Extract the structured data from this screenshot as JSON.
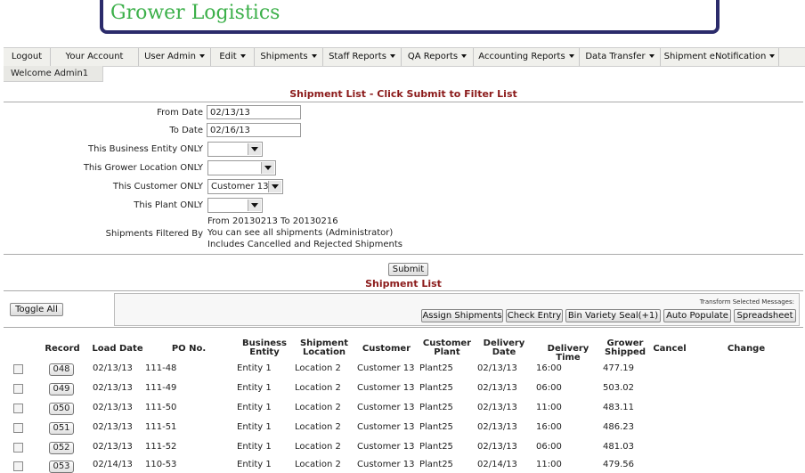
{
  "app": {
    "title": "Grower Logistics"
  },
  "menu": [
    {
      "label": "Logout",
      "dropdown": false
    },
    {
      "label": "Your Account",
      "dropdown": false
    },
    {
      "label": "User Admin",
      "dropdown": true
    },
    {
      "label": "Edit",
      "dropdown": true
    },
    {
      "label": "Shipments",
      "dropdown": true
    },
    {
      "label": "Staff Reports",
      "dropdown": true
    },
    {
      "label": "QA Reports",
      "dropdown": true
    },
    {
      "label": "Accounting Reports",
      "dropdown": true
    },
    {
      "label": "Data Transfer",
      "dropdown": true
    },
    {
      "label": "Shipment eNotification",
      "dropdown": true
    }
  ],
  "welcome": "Welcome Admin1",
  "filter": {
    "title": "Shipment List - Click Submit to Filter List",
    "from_date_label": "From Date",
    "from_date": "02/13/13",
    "to_date_label": "To Date",
    "to_date": "02/16/13",
    "business_entity_label": "This Business Entity ONLY",
    "business_entity": "",
    "grower_location_label": "This Grower Location ONLY",
    "grower_location": "",
    "customer_label": "This Customer ONLY",
    "customer": "Customer 13",
    "plant_label": "This Plant ONLY",
    "plant": "",
    "filtered_by_label": "Shipments Filtered By",
    "filtered_by": [
      "From 20130213 To 20130216",
      "You can see all shipments (Administrator)",
      "Includes Cancelled and Rejected Shipments"
    ],
    "submit_label": "Submit"
  },
  "list": {
    "title": "Shipment List",
    "toggle_all": "Toggle All",
    "transform_label": "Transform Selected Messages:",
    "actions": [
      "Assign Shipments",
      "Check Entry",
      "Bin Variety Seal(+1)",
      "Auto Populate",
      "Spreadsheet"
    ],
    "headers": [
      "Record",
      "Load Date",
      "PO No.",
      "Business Entity",
      "Shipment Location",
      "Customer",
      "Customer Plant",
      "Delivery Date",
      "Delivery Time",
      "Grower Shipped",
      "Cancel",
      "Change"
    ],
    "rows": [
      {
        "record": "048",
        "load_date": "02/13/13",
        "po": "111-48",
        "entity": "Entity 1",
        "location": "Location 2",
        "customer": "Customer 13",
        "plant": "Plant25",
        "delivery_date": "02/13/13",
        "delivery_time": "16:00",
        "shipped": "477.19"
      },
      {
        "record": "049",
        "load_date": "02/13/13",
        "po": "111-49",
        "entity": "Entity 1",
        "location": "Location 2",
        "customer": "Customer 13",
        "plant": "Plant25",
        "delivery_date": "02/13/13",
        "delivery_time": "06:00",
        "shipped": "503.02"
      },
      {
        "record": "050",
        "load_date": "02/13/13",
        "po": "111-50",
        "entity": "Entity 1",
        "location": "Location 2",
        "customer": "Customer 13",
        "plant": "Plant25",
        "delivery_date": "02/13/13",
        "delivery_time": "11:00",
        "shipped": "483.11"
      },
      {
        "record": "051",
        "load_date": "02/13/13",
        "po": "111-51",
        "entity": "Entity 1",
        "location": "Location 2",
        "customer": "Customer 13",
        "plant": "Plant25",
        "delivery_date": "02/13/13",
        "delivery_time": "16:00",
        "shipped": "486.23"
      },
      {
        "record": "052",
        "load_date": "02/13/13",
        "po": "111-52",
        "entity": "Entity 1",
        "location": "Location 2",
        "customer": "Customer 13",
        "plant": "Plant25",
        "delivery_date": "02/13/13",
        "delivery_time": "06:00",
        "shipped": "481.03"
      },
      {
        "record": "053",
        "load_date": "02/14/13",
        "po": "110-53",
        "entity": "Entity 1",
        "location": "Location 2",
        "customer": "Customer 13",
        "plant": "Plant25",
        "delivery_date": "02/14/13",
        "delivery_time": "11:00",
        "shipped": "479.56"
      }
    ]
  }
}
